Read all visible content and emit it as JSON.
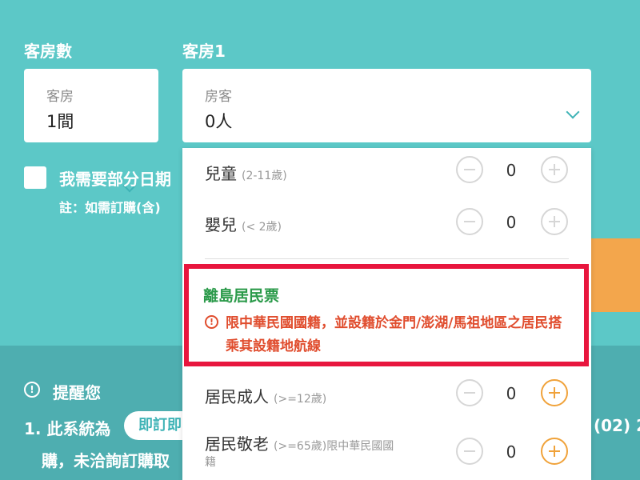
{
  "room_count": {
    "section_label": "客房數",
    "caption": "客房",
    "value": "1間"
  },
  "room1": {
    "section_label": "客房1",
    "caption": "房客",
    "value": "0人"
  },
  "partial_dates": {
    "label": "我需要部分日期",
    "note": "註：如需訂購(含)"
  },
  "dropdown": {
    "rows": [
      {
        "label": "兒童",
        "sub": "(2-11歲)",
        "count": "0",
        "plus_active": false
      },
      {
        "label": "嬰兒",
        "sub": "(< 2歲)",
        "count": "0",
        "plus_active": false
      },
      {
        "label": "居民成人",
        "sub": "(>=12歲)",
        "count": "0",
        "plus_active": true
      },
      {
        "label": "居民敬老",
        "sub": "(>=65歲)限中華民國國",
        "sub2": "籍",
        "count": "0",
        "plus_active": true
      }
    ],
    "island_title": "離島居民票",
    "island_warning": "限中華民國國籍，並設籍於金門/澎湖/馬祖地區之居民搭乘其設籍地航線"
  },
  "reminder": {
    "title": "提醒您",
    "line1_prefix": "1. 此系統為",
    "pill": "即訂即",
    "line1_right": "(02) 2",
    "line2": "購，未洽詢訂購取"
  },
  "colors": {
    "teal": "#5cc8c7",
    "orange": "#f3a64c",
    "highlight_red": "#e8163e",
    "green": "#2b9a4a",
    "warning_red": "#e04d2e"
  }
}
